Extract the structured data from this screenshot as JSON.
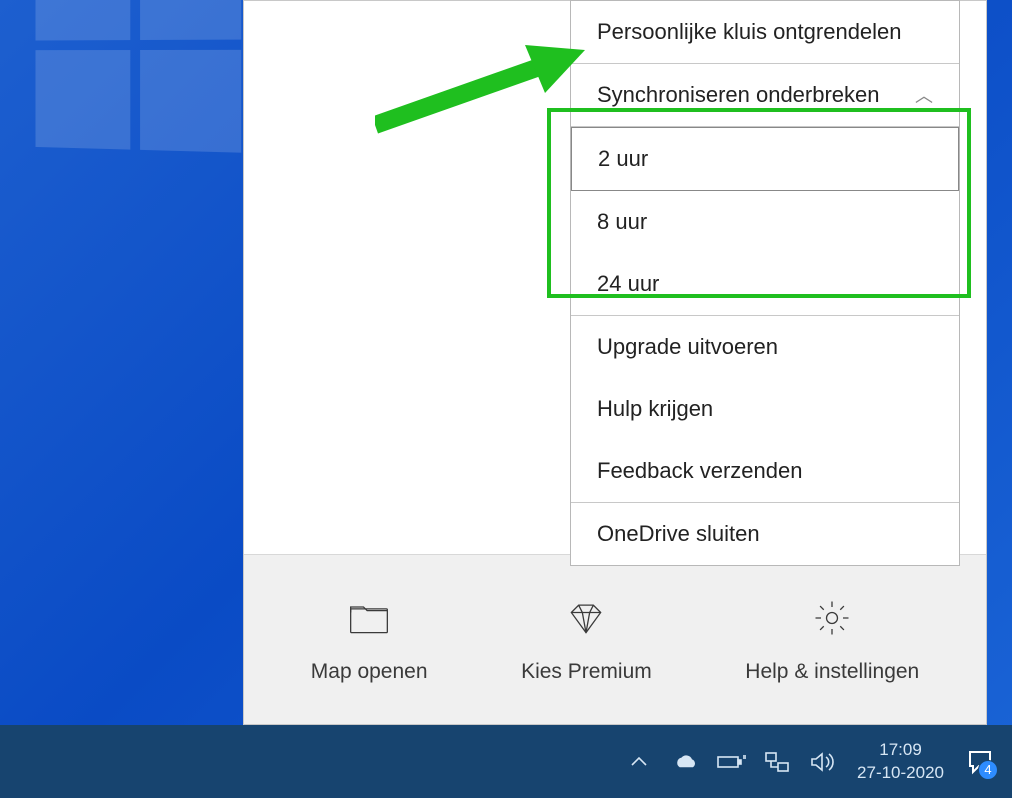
{
  "menu": {
    "unlock_vault": "Persoonlijke kluis ontgrendelen",
    "pause_sync": "Synchroniseren onderbreken",
    "pause_options": {
      "opt1": "2 uur",
      "opt2": "8 uur",
      "opt3": "24 uur"
    },
    "upgrade": "Upgrade uitvoeren",
    "get_help": "Hulp krijgen",
    "send_feedback": "Feedback verzenden",
    "close_onedrive": "OneDrive sluiten"
  },
  "bottom": {
    "open_folder": "Map openen",
    "premium": "Kies Premium",
    "help_settings": "Help & instellingen"
  },
  "tray": {
    "time": "17:09",
    "date": "27-10-2020",
    "notification_count": "4"
  }
}
